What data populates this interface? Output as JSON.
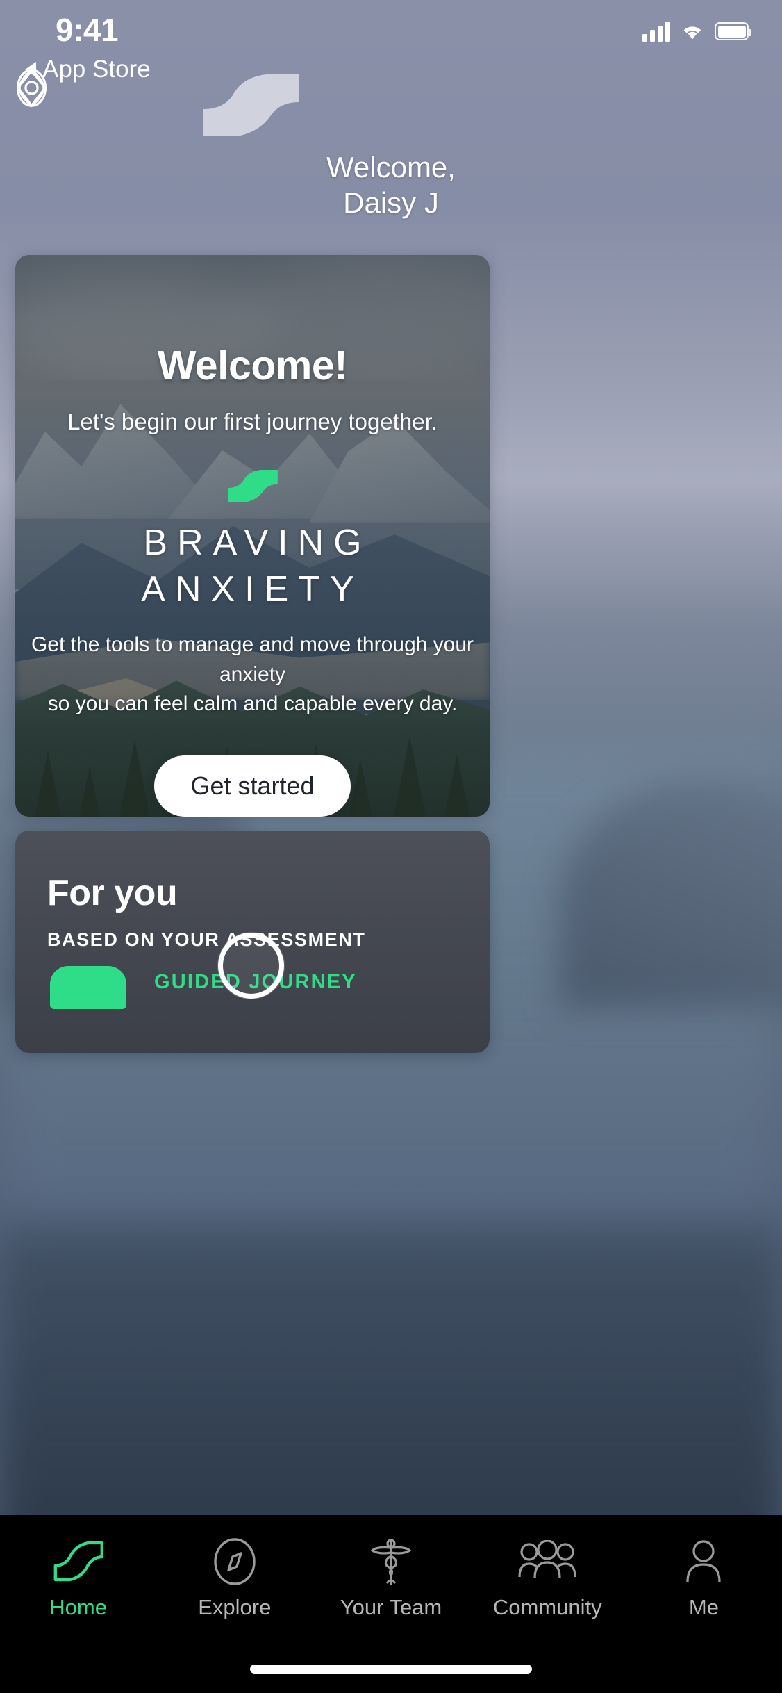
{
  "status_bar": {
    "time": "9:41",
    "signal_icon": "cellular-signal-icon",
    "wifi_icon": "wifi-icon",
    "battery_icon": "battery-icon"
  },
  "back_link": {
    "label": "App Store",
    "icon": "back-triangle-icon"
  },
  "header": {
    "brand_icon": "brand-emblem-icon",
    "wave_icon": "s-curve-logo-icon",
    "greeting_line1": "Welcome,",
    "greeting_line2": "Daisy J"
  },
  "hero_card": {
    "title": "Welcome!",
    "subtitle": "Let's begin our first journey together.",
    "wave_icon": "s-curve-logo-icon",
    "program_name": "BRAVING ANXIETY",
    "description_line1": "Get the tools to manage and move through your anxiety",
    "description_line2": "so you can feel calm and capable every day.",
    "cta_label": "Get started",
    "background": "mountain-landscape-photo"
  },
  "for_you_card": {
    "title": "For you",
    "kicker": "BASED ON YOUR ASSESSMENT",
    "item_tag": "GUIDED JOURNEY",
    "item_thumbnail": "green-journey-thumbnail"
  },
  "touch_indicator": {
    "name": "tap-highlight-ring"
  },
  "tab_bar": {
    "items": [
      {
        "label": "Home",
        "icon": "home-wave-icon",
        "active": true
      },
      {
        "label": "Explore",
        "icon": "compass-icon",
        "active": false
      },
      {
        "label": "Your Team",
        "icon": "caduceus-icon",
        "active": false
      },
      {
        "label": "Community",
        "icon": "people-group-icon",
        "active": false
      },
      {
        "label": "Me",
        "icon": "person-icon",
        "active": false
      }
    ]
  },
  "colors": {
    "accent_green": "#2fdc88",
    "background_blue_gray": "#848ba8",
    "card_dark": "#4d5059",
    "tab_bar": "#000000",
    "text_white": "#ffffff",
    "tab_inactive": "#b6b6b6"
  }
}
